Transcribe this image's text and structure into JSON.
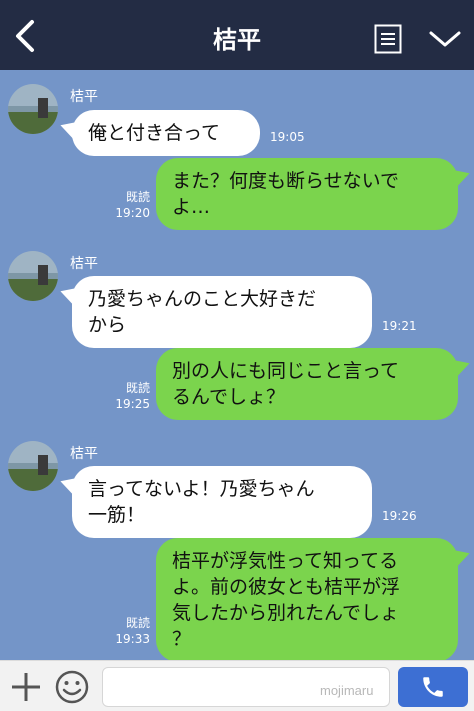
{
  "header": {
    "title": "桔平",
    "back_icon": "chevron-left-icon",
    "menu_icon": "list-icon",
    "dropdown_icon": "chevron-down-icon"
  },
  "messages": [
    {
      "sender": "桔平",
      "direction": "in",
      "text": "俺と付き合って",
      "time": "19:05"
    },
    {
      "direction": "out",
      "text": "また？何度も断らせないで\nよ…",
      "read": "既読",
      "time": "19:20"
    },
    {
      "sender": "桔平",
      "direction": "in",
      "text": "乃愛ちゃんのこと大好きだ\nから",
      "time": "19:21"
    },
    {
      "direction": "out",
      "text": "別の人にも同じこと言って\nるんでしょ？",
      "read": "既読",
      "time": "19:25"
    },
    {
      "sender": "桔平",
      "direction": "in",
      "text": "言ってないよ！乃愛ちゃん\n一筋！",
      "time": "19:26"
    },
    {
      "direction": "out",
      "text": "桔平が浮気性って知ってる\nよ。前の彼女とも桔平が浮\n気したから別れたんでしょ\n？",
      "read": "既読",
      "time": "19:33"
    }
  ],
  "inputbar": {
    "placeholder": "",
    "watermark": "mojimaru",
    "plus_icon": "plus-icon",
    "emoji_icon": "smile-icon",
    "call_icon": "phone-icon"
  },
  "colors": {
    "header_bg": "#232c44",
    "chat_bg": "#7495c8",
    "outgoing_bubble": "#7bd44d",
    "incoming_bubble": "#ffffff",
    "call_button": "#3d6fd3"
  }
}
